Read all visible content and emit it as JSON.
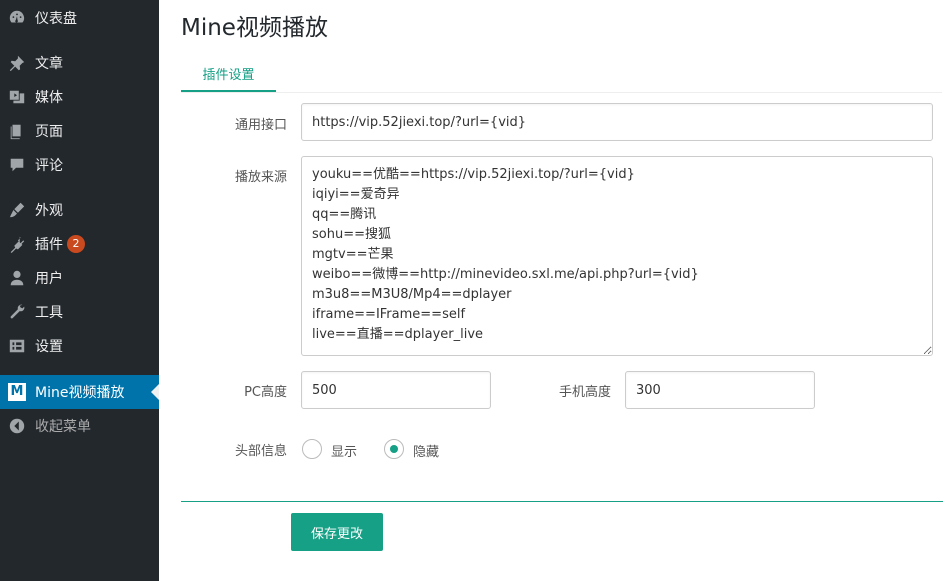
{
  "sidebar": {
    "items": [
      {
        "label": "仪表盘",
        "icon": "dashboard-icon"
      },
      {
        "label": "文章",
        "icon": "pin-icon"
      },
      {
        "label": "媒体",
        "icon": "media-icon"
      },
      {
        "label": "页面",
        "icon": "page-icon"
      },
      {
        "label": "评论",
        "icon": "comment-icon"
      },
      {
        "label": "外观",
        "icon": "brush-icon"
      },
      {
        "label": "插件",
        "icon": "plugin-icon",
        "badge": "2"
      },
      {
        "label": "用户",
        "icon": "user-icon"
      },
      {
        "label": "工具",
        "icon": "wrench-icon"
      },
      {
        "label": "设置",
        "icon": "settings-icon"
      },
      {
        "label": "Mine视频播放",
        "icon": "m-logo-icon",
        "logo_text": "M",
        "active": true
      },
      {
        "label": "收起菜单",
        "icon": "collapse-icon"
      }
    ]
  },
  "page": {
    "title": "Mine视频播放",
    "tab": "插件设置"
  },
  "form": {
    "api_label": "通用接口",
    "api_value": "https://vip.52jiexi.top/?url={vid}",
    "sources_label": "播放来源",
    "sources_lines": [
      "youku==优酷==https://vip.52jiexi.top/?url={vid}",
      "iqiyi==爱奇异",
      "qq==腾讯",
      "sohu==搜狐",
      "mgtv==芒果",
      "weibo==微博==http://minevideo.sxl.me/api.php?url={vid}",
      "m3u8==M3U8/Mp4==dplayer",
      "iframe==IFrame==self",
      "live==直播==dplayer_live"
    ],
    "pc_height_label": "PC高度",
    "pc_height_value": "500",
    "mobile_height_label": "手机高度",
    "mobile_height_value": "300",
    "header_label": "头部信息",
    "header_options": [
      {
        "label": "显示",
        "checked": false
      },
      {
        "label": "隐藏",
        "checked": true
      }
    ],
    "save_label": "保存更改"
  },
  "colors": {
    "sidebar_bg": "#23282d",
    "active_bg": "#0073aa",
    "accent": "#16a085",
    "badge": "#ca4a1f"
  }
}
